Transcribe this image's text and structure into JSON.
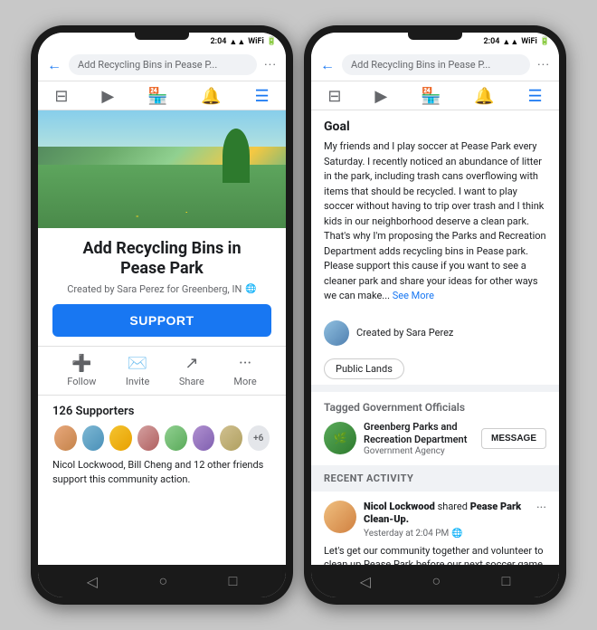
{
  "app": {
    "title": "Add Recycling Bins in Pease P..."
  },
  "phone1": {
    "status_time": "2:04",
    "nav": {
      "back": "←",
      "search_text": "Add Recycling Bins in Pease P...",
      "dots": "···"
    },
    "petition": {
      "title": "Add Recycling Bins in\nPease Park",
      "meta": "Created by Sara Perez for Greenberg, IN",
      "support_label": "SUPPORT"
    },
    "actions": [
      {
        "icon": "➕",
        "label": "Follow"
      },
      {
        "icon": "✉",
        "label": "Invite"
      },
      {
        "icon": "↗",
        "label": "Share"
      },
      {
        "icon": "···",
        "label": "More"
      }
    ],
    "supporters": {
      "count": "126 Supporters",
      "names_text": "Nicol Lockwood, Bill Cheng and 12 other friends support this community action.",
      "plus_count": "+6"
    }
  },
  "phone2": {
    "status_time": "2:04",
    "nav": {
      "back": "←",
      "search_text": "Add Recycling Bins in Pease P...",
      "dots": "···"
    },
    "goal": {
      "title": "Goal",
      "text": "My friends and I play soccer at Pease Park every Saturday. I recently noticed an abundance of litter in the park, including trash cans overflowing with items that should be recycled. I want to play soccer without having to trip over trash and I think kids in our neighborhood deserve a clean park. That's why I'm proposing the Parks and Recreation Department adds recycling bins in Pease park. Please support this cause if you want to see a cleaner park and share your ideas for other ways we can make...",
      "see_more": "See More"
    },
    "creator": "Created by Sara Perez",
    "tag": "Public Lands",
    "tagged_section": "Tagged Government Officials",
    "gov_official": {
      "name": "Greenberg Parks and Recreation Department",
      "type": "Government Agency",
      "message_btn": "MESSAGE"
    },
    "recent_activity": {
      "header": "RECENT ACTIVITY",
      "item": {
        "user": "Nicol Lockwood",
        "action": "shared",
        "petition": "Pease Park Clean-Up.",
        "time": "Yesterday at 2:04 PM",
        "text": "Let's get our community together and volunteer to clean up Pease Park before our next soccer game"
      }
    }
  },
  "bottom_nav": {
    "back": "◁",
    "home": "○",
    "square": "□"
  }
}
